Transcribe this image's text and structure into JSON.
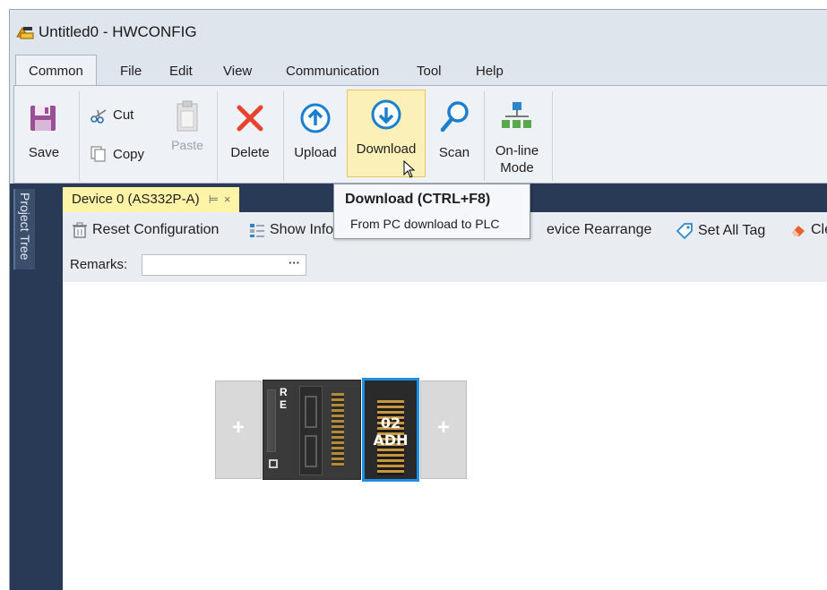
{
  "window": {
    "title": "Untitled0 - HWCONFIG"
  },
  "menu": {
    "items": [
      "Common",
      "File",
      "Edit",
      "View",
      "Communication",
      "Tool",
      "Help"
    ],
    "active": "Common"
  },
  "ribbon": {
    "save": "Save",
    "cut": "Cut",
    "copy": "Copy",
    "paste": "Paste",
    "delete": "Delete",
    "upload": "Upload",
    "download": "Download",
    "scan": "Scan",
    "online_mode_line1": "On-line",
    "online_mode_line2": "Mode"
  },
  "tooltip": {
    "title": "Download (CTRL+F8)",
    "body": "From PC download to PLC"
  },
  "sidebar": {
    "project_tree": "Project Tree"
  },
  "document_tab": {
    "label": "Device 0 (AS332P-A)",
    "pin": "⊨",
    "close": "×"
  },
  "toolbar": {
    "reset_configuration": "Reset Configuration",
    "show_info": "Show Info",
    "device_rearrange": "Device Rearrange",
    "device_rearrange_visible": "evice Rearrange",
    "set_all_tag": "Set All Tag",
    "clear_partial": "Cle"
  },
  "remarks": {
    "label": "Remarks:",
    "value": "",
    "button": "···"
  },
  "rack": {
    "cpu_label_1": "R",
    "cpu_label_2": "E",
    "module_label_1": "02",
    "module_label_2": "ADH",
    "plus_left": "+",
    "plus_right": "+"
  },
  "colors": {
    "sidebar_bg": "#283a55",
    "tab_active": "#fff3a8",
    "hover_bg": "#fbf0b8",
    "selection": "#1e8ee6",
    "delete_red": "#e8432c",
    "icon_blue": "#1a7fd0",
    "save_purple": "#9b4f96"
  }
}
